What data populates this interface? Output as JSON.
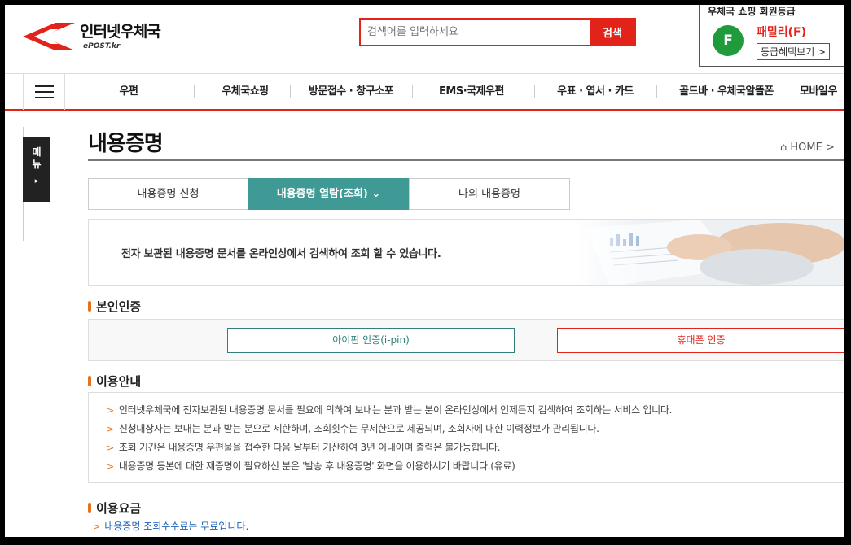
{
  "header": {
    "logo_title": "인터넷우체국",
    "logo_sub": "ePOST.kr",
    "search_placeholder": "검색어를 입력하세요",
    "search_button": "검색",
    "member": {
      "title": "우체국 쇼핑 회원등급",
      "badge": "F",
      "grade": "패밀리(F)",
      "benefits_button": "등급혜택보기 >"
    }
  },
  "gnb": {
    "items": [
      "우편",
      "우체국쇼핑",
      "방문접수 · 창구소포",
      "EMS·국제우편",
      "우표 · 엽서 · 카드",
      "골드바 · 우체국알뜰폰",
      "모바일우"
    ]
  },
  "side_menu": {
    "label_1": "메",
    "label_2": "뉴",
    "arrow": "▸"
  },
  "page": {
    "title": "내용증명",
    "breadcrumb": "⌂ HOME  >"
  },
  "tabs": [
    {
      "label": "내용증명 신청",
      "active": false
    },
    {
      "label": "내용증명 열람(조회)  ⌄",
      "active": true
    },
    {
      "label": "나의 내용증명",
      "active": false
    }
  ],
  "intro": {
    "text": "전자 보관된 내용증명 문서를 온라인상에서 검색하여 조회 할 수 있습니다."
  },
  "auth": {
    "title": "본인인증",
    "ipin_button": "아이핀 인증(i-pin)",
    "phone_button": "휴대폰 인증"
  },
  "usage": {
    "title": "이용안내",
    "items": [
      "인터넷우체국에 전자보관된 내용증명 문서를 필요에 의하여 보내는 분과 받는 분이 온라인상에서 언제든지 검색하여 조회하는 서비스 입니다.",
      "신청대상자는 보내는 분과 받는 분으로 제한하며, 조회횟수는 무제한으로 제공되며, 조회자에 대한 이력정보가 관리됩니다.",
      "조회 기간은 내용증명 우편물을 접수한 다음 날부터 기산하여 3년 이내이며 출력은 불가능합니다.",
      "내용증명 등본에 대한 재증명이 필요하신 분은 '발송 후 내용증명' 화면을 이용하시기 바랍니다.(유료)"
    ]
  },
  "fee": {
    "title": "이용요금",
    "text": "내용증명 조회수수료는 무료입니다."
  },
  "colors": {
    "brand_red": "#e2231a",
    "active_tab": "#3f9a95",
    "accent_orange": "#e8711d",
    "badge_green": "#1f9b3b"
  }
}
